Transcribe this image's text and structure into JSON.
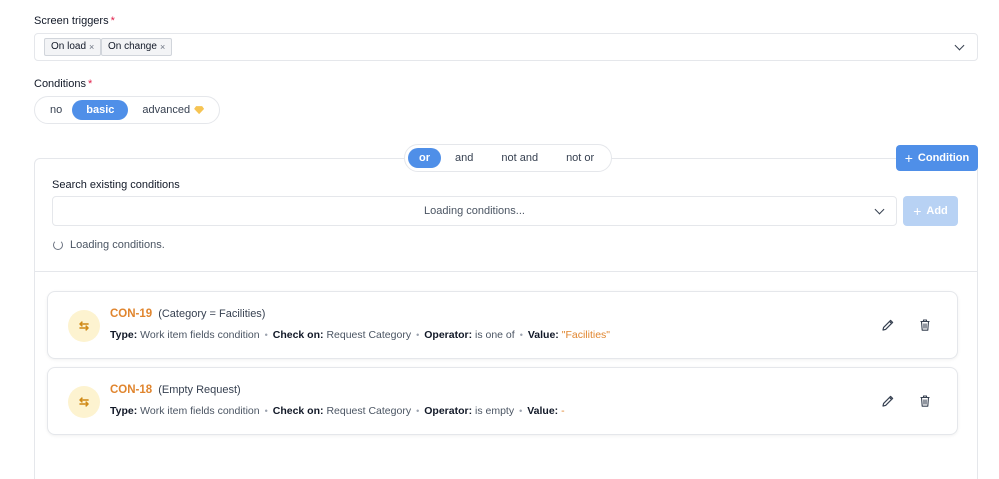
{
  "screen_triggers": {
    "label": "Screen triggers",
    "required_mark": "*",
    "tags": [
      {
        "label": "On load",
        "remove": "×"
      },
      {
        "label": "On change",
        "remove": "×"
      }
    ]
  },
  "conditions": {
    "label": "Conditions",
    "required_mark": "*",
    "modes": [
      "no",
      "basic",
      "advanced"
    ],
    "active_mode": "basic"
  },
  "logic": {
    "options": [
      "or",
      "and",
      "not and",
      "not or"
    ],
    "active": "or"
  },
  "add_condition_button": "Condition",
  "search": {
    "label": "Search existing conditions",
    "placeholder": "Loading conditions...",
    "add_button": "Add"
  },
  "loading_text": "Loading conditions.",
  "cards": [
    {
      "icon": "⇆",
      "id": "CON-19",
      "desc": "(Category = Facilities)",
      "type_label": "Type:",
      "type": "Work item fields condition",
      "check_label": "Check on:",
      "check": "Request Category",
      "operator_label": "Operator:",
      "operator": "is one of",
      "value_label": "Value:",
      "value": "\"Facilities\""
    },
    {
      "icon": "⇆",
      "id": "CON-18",
      "desc": "(Empty Request)",
      "type_label": "Type:",
      "type": "Work item fields condition",
      "check_label": "Check on:",
      "check": "Request Category",
      "operator_label": "Operator:",
      "operator": "is empty",
      "value_label": "Value:",
      "value": "-"
    }
  ],
  "colors": {
    "primary": "#4f8fe8",
    "accent_orange": "#e0852e",
    "required": "#e11d48"
  }
}
